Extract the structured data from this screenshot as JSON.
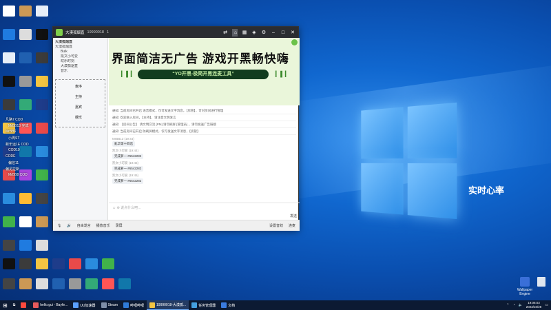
{
  "desktop": {
    "right_label": "实时心率",
    "corner_icons": [
      {
        "label": "Wallpaper Engine"
      },
      {
        "label": ""
      }
    ],
    "overlay_names": [
      "凡路7 COD",
      "MrBB13 完成",
      "MrBB6",
      "小周ST",
      "新年运1E COD",
      "COD19",
      "CODE",
      "偏信11",
      "偏见拉新",
      "MrBB8 COD"
    ]
  },
  "app": {
    "title": "大漠孤烟直",
    "room_id": "19990018",
    "online": "1",
    "sidebar": {
      "header": "大漠孤烟直",
      "items": [
        "大漠孤烟直",
        "Bulk",
        "凯文小可爱",
        "欢乐时刻",
        "大漠孤烟直",
        "音乐"
      ],
      "grid_labels": [
        "麦序",
        "主持",
        "嘉宾",
        "娱乐"
      ]
    },
    "banner": {
      "headline": "界面简洁无广告  游戏开黑畅快嗨",
      "pill": "“YO开黑-极简开黑连麦工具”"
    },
    "chat": {
      "notices": [
        "通知: 当前房间已开启 语音模式，仅可发送文字消息，【房管】，可对房间进行管理",
        "通知: 欢迎进入房间，【主持】，请注意文明发言",
        "通知: 【房间公告】 请文明交流 [PM] 请勿刷屏 [管理员] ，请勿发送广告链接",
        "通知: 当前房间已开启 防刷屏模式，仅可发送文字消息，【房管】"
      ],
      "messages": [
        {
          "name": "MrBB13 (19:44)",
          "text": "亂华第十四话"
        },
        {
          "name": "凯文小可爱 (19:44)",
          "text": "完成萝一 #6542282"
        },
        {
          "name": "凯文小可爱 (19:45)",
          "text": "完成萝一 #6542282"
        },
        {
          "name": "凯文小可爱 (19:45)",
          "text": "完成萝一 #6542282"
        }
      ],
      "input_placeholder": "说点什么吧...",
      "send_label": "发送"
    },
    "bottombar": {
      "left": [
        "自由发言",
        "播放音乐",
        "录屏"
      ],
      "right": [
        "设置音效",
        "连麦"
      ]
    }
  },
  "taskbar": {
    "items": [
      {
        "label": "",
        "color": "#ff4a3d"
      },
      {
        "label": "hello.gui - Bayfe...",
        "color": "#e85b5b"
      },
      {
        "label": "UU加速器",
        "color": "#5aa0ff"
      },
      {
        "label": "Steam",
        "color": "#7e8ea8"
      },
      {
        "label": "哔哩哔哩",
        "color": "#2f7bd8"
      },
      {
        "label": "19990018-大漠孤...",
        "color": "#f5c542",
        "active": true
      },
      {
        "label": "任务管理器",
        "color": "#44a0e0"
      },
      {
        "label": "文档",
        "color": "#3a7be0"
      }
    ],
    "clock_time": "19:06:03",
    "clock_date": "2023/10/28"
  }
}
